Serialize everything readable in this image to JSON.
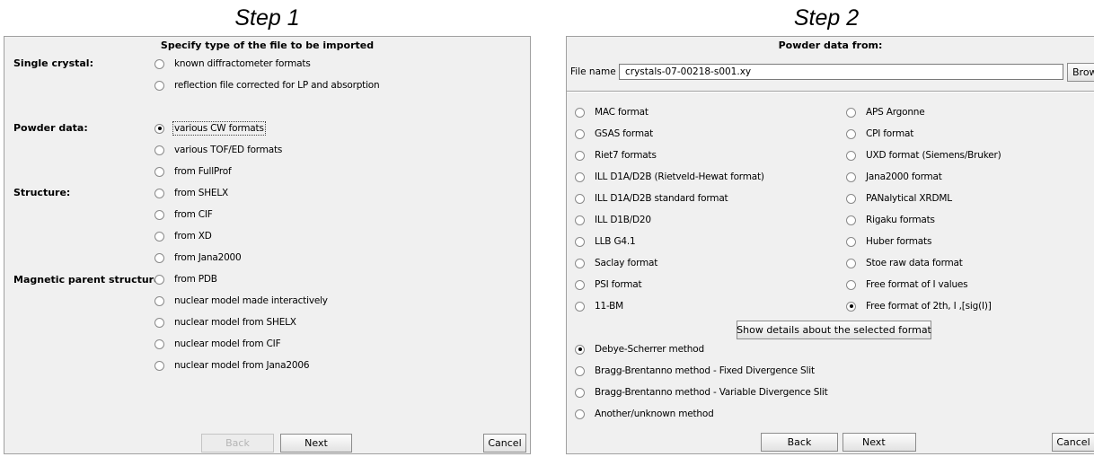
{
  "step1": {
    "title": "Step 1",
    "heading": "Specify type of the file to be imported",
    "groups": {
      "single_crystal": "Single crystal:",
      "powder": "Powder data:",
      "structure": "Structure:",
      "magnetic": "Magnetic parent structure:"
    },
    "options": [
      {
        "label": "known diffractometer formats",
        "selected": false
      },
      {
        "label": "reflection file corrected for LP and absorption",
        "selected": false
      },
      {
        "label": "various CW formats",
        "selected": true
      },
      {
        "label": "various TOF/ED formats",
        "selected": false
      },
      {
        "label": "from FullProf",
        "selected": false
      },
      {
        "label": "from SHELX",
        "selected": false
      },
      {
        "label": "from CIF",
        "selected": false
      },
      {
        "label": "from XD",
        "selected": false
      },
      {
        "label": "from Jana2000",
        "selected": false
      },
      {
        "label": "from PDB",
        "selected": false
      },
      {
        "label": "nuclear model made interactively",
        "selected": false
      },
      {
        "label": "nuclear model from SHELX",
        "selected": false
      },
      {
        "label": "nuclear model from CIF",
        "selected": false
      },
      {
        "label": "nuclear model from Jana2006",
        "selected": false
      }
    ],
    "buttons": {
      "back": "Back",
      "next": "Next",
      "cancel": "Cancel"
    }
  },
  "step2": {
    "title": "Step 2",
    "heading": "Powder data from:",
    "file_label": "File name",
    "file_value": "crystals-07-00218-s001.xy",
    "browse": "Browse",
    "formats_left": [
      "MAC format",
      "GSAS format",
      "Riet7 formats",
      "ILL D1A/D2B (Rietveld-Hewat format)",
      "ILL D1A/D2B standard format",
      "ILL D1B/D20",
      "LLB G4.1",
      "Saclay format",
      "PSI format",
      "11-BM"
    ],
    "formats_right": [
      "APS Argonne",
      "CPI format",
      "UXD format (Siemens/Bruker)",
      "Jana2000 format",
      "PANalytical XRDML",
      "Rigaku formats",
      "Huber formats",
      "Stoe raw data format",
      "Free format of I values",
      "Free format of 2th, I ,[sig(I)]"
    ],
    "selected_format": "Free format of 2th, I ,[sig(I)]",
    "details_button": "Show details about the selected format",
    "methods": [
      "Debye-Scherrer method",
      "Bragg-Brentanno method - Fixed Divergence Slit",
      "Bragg-Brentanno method - Variable Divergence Slit",
      "Another/unknown method"
    ],
    "selected_method": "Debye-Scherrer method",
    "buttons": {
      "back": "Back",
      "next": "Next",
      "cancel": "Cancel"
    }
  }
}
